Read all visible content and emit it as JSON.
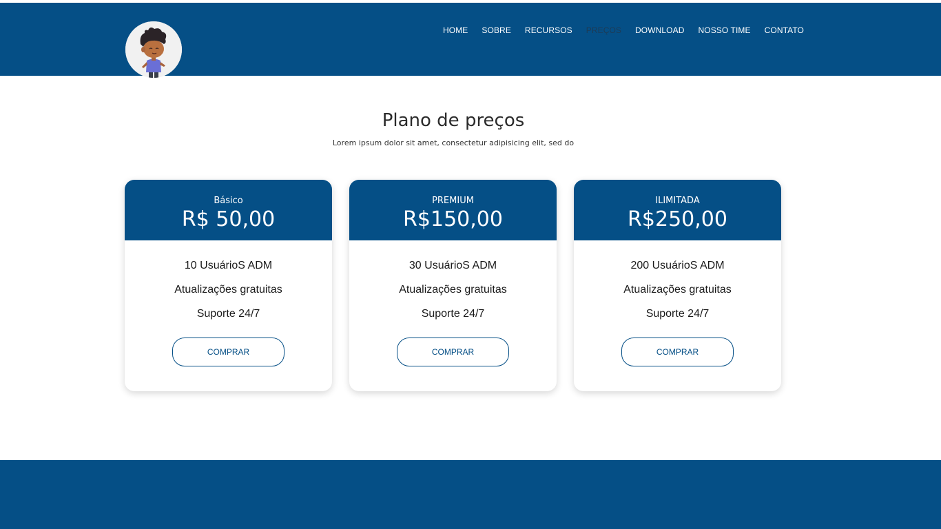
{
  "nav": {
    "items": [
      "HOME",
      "SOBRE",
      "RECURSOS",
      "PREÇOS",
      "DOWNLOAD",
      "NOSSO TIME",
      "CONTATO"
    ],
    "active": "PREÇOS"
  },
  "section": {
    "title": "Plano de preços",
    "subtitle": "Lorem ipsum dolor sit amet, consectetur adipisicing elit, sed do"
  },
  "plans": [
    {
      "name": "Básico",
      "price": "R$ 50,00",
      "features": [
        "10 UsuárioS ADM",
        "Atualizações gratuitas",
        "Suporte 24/7"
      ],
      "button": "COMPRAR"
    },
    {
      "name": "PREMIUM",
      "price": "R$150,00",
      "features": [
        "30 UsuárioS ADM",
        "Atualizações gratuitas",
        "Suporte 24/7"
      ],
      "button": "COMPRAR"
    },
    {
      "name": "ILIMITADA",
      "price": "R$250,00",
      "features": [
        "200 UsuárioS ADM",
        "Atualizações gratuitas",
        "Suporte 24/7"
      ],
      "button": "COMPRAR"
    }
  ],
  "colors": {
    "primary": "#054f86",
    "active_nav": "#1d3b55",
    "background": "#ffffff"
  },
  "icons": {
    "logo": "avatar-logo-icon"
  }
}
